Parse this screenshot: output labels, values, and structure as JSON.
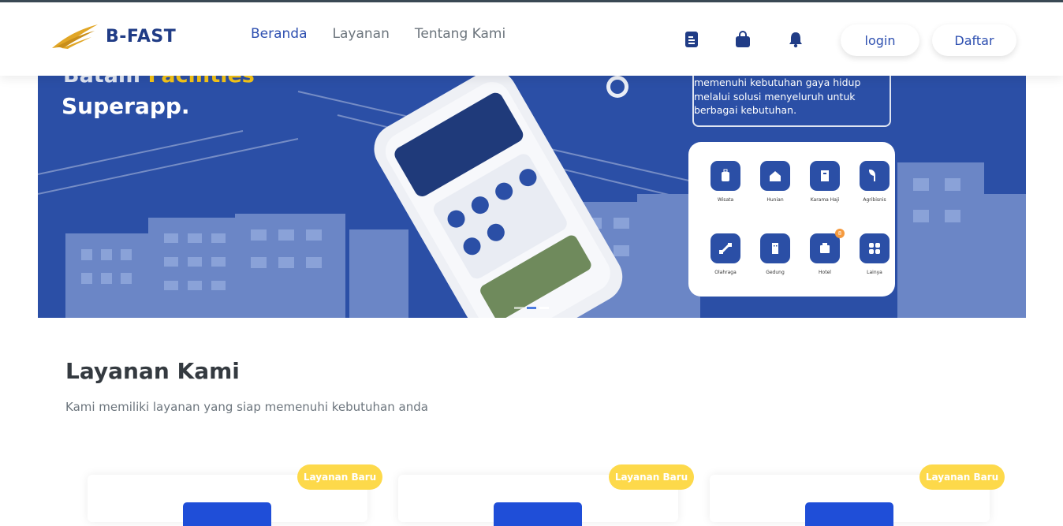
{
  "brand": {
    "name": "B-FAST"
  },
  "nav": {
    "items": [
      {
        "label": "Beranda",
        "active": true
      },
      {
        "label": "Layanan",
        "active": false
      },
      {
        "label": "Tentang Kami",
        "active": false
      }
    ]
  },
  "header_icons": [
    "document-icon",
    "shopping-bag-icon",
    "bell-icon"
  ],
  "auth": {
    "login_label": "login",
    "register_label": "Daftar"
  },
  "banner": {
    "headline_part1": "Batam ",
    "headline_highlight": "Facilities",
    "headline_line2": "Superapp.",
    "description_lines": [
      "memenuhi kebutuhan gaya hidup",
      "melalui solusi menyeluruh untuk",
      "berbagai kebutuhan."
    ],
    "services": [
      {
        "label": "Wisata",
        "icon": "luggage-icon"
      },
      {
        "label": "Hunian",
        "icon": "house-icon"
      },
      {
        "label": "Karama Haji",
        "icon": "building-icon"
      },
      {
        "label": "Agribisnis",
        "icon": "plant-icon"
      },
      {
        "label": "Olahraga",
        "icon": "dumbbell-icon"
      },
      {
        "label": "Gedung",
        "icon": "office-icon"
      },
      {
        "label": "Hotel",
        "icon": "hotel-icon",
        "badge": "8"
      },
      {
        "label": "Lainya",
        "icon": "grid-icon"
      }
    ],
    "slides": 3,
    "active_slide": 3
  },
  "services_section": {
    "title": "Layanan Kami",
    "subtitle": "Kami memiliki layanan yang siap memenuhi kebutuhan anda",
    "cards": [
      {
        "badge": "Layanan Baru"
      },
      {
        "badge": "Layanan Baru"
      },
      {
        "badge": "Layanan Baru"
      }
    ]
  },
  "colors": {
    "primary": "#2b4fa6",
    "nav_active": "#2d4fb0",
    "badge_yellow": "#fdd94a",
    "highlight": "#f5c518"
  }
}
